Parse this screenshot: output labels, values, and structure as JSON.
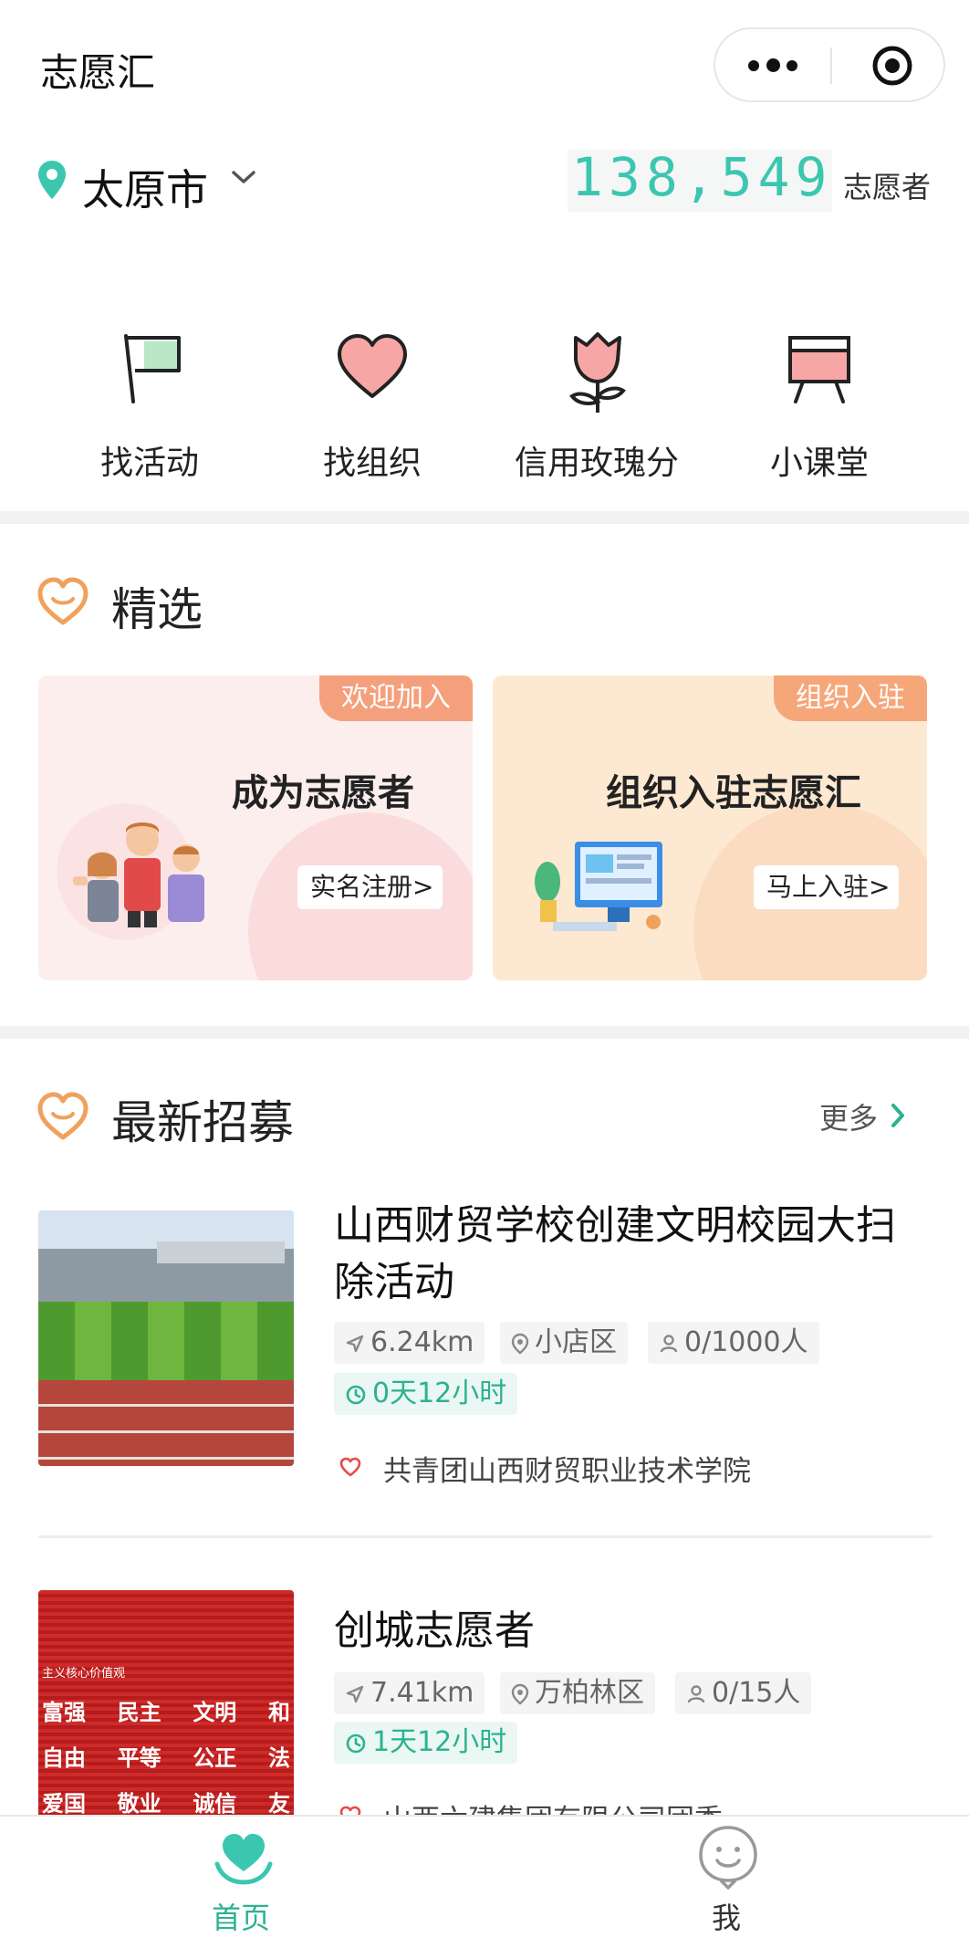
{
  "header": {
    "title": "志愿汇"
  },
  "location": {
    "city": "太原市",
    "volunteer_count": "138,549",
    "volunteer_count_label": "志愿者"
  },
  "quick_menu": [
    {
      "label": "找活动",
      "icon": "flag-icon"
    },
    {
      "label": "找组织",
      "icon": "heart-icon"
    },
    {
      "label": "信用玫瑰分",
      "icon": "rose-icon"
    },
    {
      "label": "小课堂",
      "icon": "easel-icon"
    }
  ],
  "featured": {
    "title": "精选",
    "cards": [
      {
        "tag": "欢迎加入",
        "title": "成为志愿者",
        "button": "实名注册",
        "button_arrow": ">"
      },
      {
        "tag": "组织入驻",
        "title": "组织入驻志愿汇",
        "button": "马上入驻",
        "button_arrow": ">"
      }
    ]
  },
  "recruit": {
    "title": "最新招募",
    "more_label": "更多",
    "items": [
      {
        "title": "山西财贸学校创建文明校园大扫除活动",
        "distance": "6.24km",
        "district": "小店区",
        "quota": "0/1000人",
        "time_left": "0天12小时",
        "org": "共青团山西财贸职业技术学院"
      },
      {
        "title": "创城志愿者",
        "distance": "7.41km",
        "district": "万柏林区",
        "quota": "0/15人",
        "time_left": "1天12小时",
        "org": "山西六建集团有限公司团委"
      }
    ]
  },
  "poster_text": {
    "line1": "主义核心价值观",
    "row1": [
      "富强",
      "民主",
      "文明",
      "和"
    ],
    "row2": [
      "自由",
      "平等",
      "公正",
      "法"
    ],
    "row3": [
      "爱国",
      "敬业",
      "诚信",
      "友"
    ]
  },
  "tabbar": [
    {
      "label": "首页",
      "icon": "home-heart-icon",
      "active": true
    },
    {
      "label": "我",
      "icon": "smiley-icon",
      "active": false
    }
  ],
  "colors": {
    "accent": "#3bc6b0",
    "tab_active": "#2bb291",
    "tag_orange": "#f5a07c",
    "heart_orange": "#f0a15c"
  }
}
